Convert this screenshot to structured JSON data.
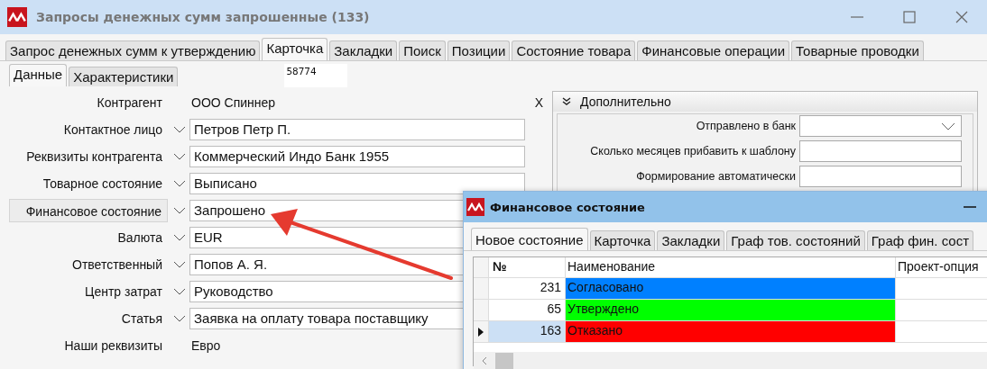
{
  "window": {
    "title": "Запросы денежных сумм запрошенные (133)"
  },
  "tabs": [
    {
      "label": "Запрос денежных сумм к утверждению",
      "selected": false
    },
    {
      "label": "Карточка",
      "selected": true
    },
    {
      "label": "Закладки",
      "selected": false
    },
    {
      "label": "Поиск",
      "selected": false
    },
    {
      "label": "Позиции",
      "selected": false
    },
    {
      "label": "Состояние товара",
      "selected": false
    },
    {
      "label": "Финансовые операции",
      "selected": false
    },
    {
      "label": "Товарные проводки",
      "selected": false
    }
  ],
  "subtabs": [
    {
      "label": "Данные",
      "selected": true
    },
    {
      "label": "Характеристики",
      "selected": false
    }
  ],
  "record_number": "58774",
  "form": [
    {
      "kind": "text",
      "label": "Контрагент",
      "value": "ООО Спиннер",
      "clear": "X",
      "focused": false
    },
    {
      "kind": "dropdown",
      "label": "Контактное лицо",
      "value": "Петров Петр П.",
      "focused": false
    },
    {
      "kind": "dropdown",
      "label": "Реквизиты контрагента",
      "value": "Коммерческий Индо Банк 1955",
      "focused": false
    },
    {
      "kind": "dropdown",
      "label": "Товарное состояние",
      "value": "Выписано",
      "focused": false
    },
    {
      "kind": "dropdown",
      "label": "Финансовое состояние",
      "value": "Запрошено",
      "focused": true
    },
    {
      "kind": "dropdown",
      "label": "Валюта",
      "value": "EUR",
      "focused": false
    },
    {
      "kind": "dropdown",
      "label": "Ответственный",
      "value": "Попов А. Я.",
      "focused": false
    },
    {
      "kind": "dropdown",
      "label": "Центр затрат",
      "value": "Руководство",
      "focused": false
    },
    {
      "kind": "dropdown",
      "label": "Статья",
      "value": "Заявка на оплату товара поставщику",
      "focused": false
    },
    {
      "kind": "text",
      "label": "Наши реквизиты",
      "value": "Евро",
      "focused": false
    }
  ],
  "extra_panel": {
    "title": "Дополнительно",
    "fields": [
      {
        "kind": "dropdown",
        "label": "Отправлено в банк"
      },
      {
        "kind": "input",
        "label": "Сколько месяцев прибавить к шаблону"
      },
      {
        "kind": "input",
        "label": "Формирование автоматически"
      }
    ]
  },
  "dialog": {
    "title": "Финансовое состояние",
    "tabs": [
      {
        "label": "Новое состояние",
        "selected": true
      },
      {
        "label": "Карточка",
        "selected": false
      },
      {
        "label": "Закладки",
        "selected": false
      },
      {
        "label": "Граф тов. состояний",
        "selected": false
      },
      {
        "label": "Граф фин. сост",
        "selected": false
      }
    ],
    "columns": [
      "№",
      "Наименование",
      "Проект-опция"
    ],
    "rows": [
      {
        "number": "231",
        "name": "Согласовано",
        "color": "#0080ff",
        "selected": false
      },
      {
        "number": "65",
        "name": "Утверждено",
        "color": "#00ff00",
        "selected": false
      },
      {
        "number": "163",
        "name": "Отказано",
        "color": "#ff0000",
        "selected": true
      }
    ]
  }
}
